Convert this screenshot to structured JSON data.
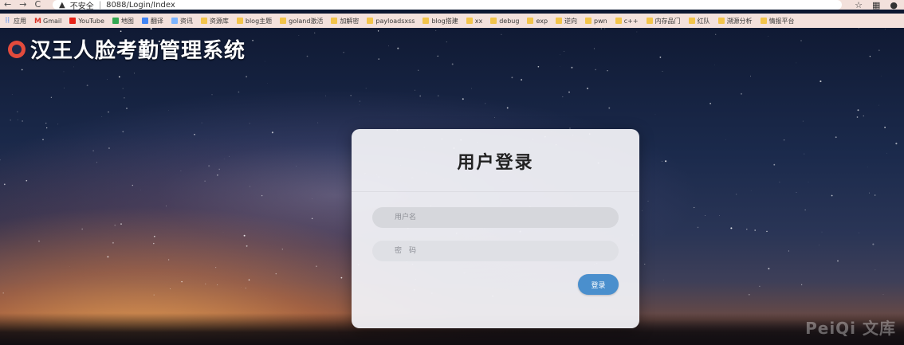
{
  "browser": {
    "nav": {
      "back": "←",
      "forward": "→",
      "reload": "C"
    },
    "address": {
      "warning": "不安全",
      "url": "8088/Login/Index"
    },
    "actions": {
      "star": "☆",
      "qr": "▦",
      "profile": "●"
    },
    "bookmarks": [
      {
        "label": "应用",
        "icon": "apps-icon"
      },
      {
        "label": "Gmail",
        "icon": "gmail-icon"
      },
      {
        "label": "YouTube",
        "icon": "youtube-icon"
      },
      {
        "label": "地图",
        "icon": "maps-icon"
      },
      {
        "label": "翻译",
        "icon": "translate-icon"
      },
      {
        "label": "资讯",
        "icon": "news-icon"
      },
      {
        "label": "资源库",
        "icon": "folder-icon"
      },
      {
        "label": "blog主题",
        "icon": "folder-icon"
      },
      {
        "label": "goland激活",
        "icon": "folder-icon"
      },
      {
        "label": "加解密",
        "icon": "folder-icon"
      },
      {
        "label": "payloadsxss",
        "icon": "folder-icon"
      },
      {
        "label": "blog搭建",
        "icon": "folder-icon"
      },
      {
        "label": "xx",
        "icon": "folder-icon"
      },
      {
        "label": "debug",
        "icon": "folder-icon"
      },
      {
        "label": "exp",
        "icon": "folder-icon"
      },
      {
        "label": "逆向",
        "icon": "folder-icon"
      },
      {
        "label": "pwn",
        "icon": "folder-icon"
      },
      {
        "label": "c++",
        "icon": "folder-icon"
      },
      {
        "label": "内存品门",
        "icon": "folder-icon"
      },
      {
        "label": "红队",
        "icon": "folder-icon"
      },
      {
        "label": "溯源分析",
        "icon": "folder-icon"
      },
      {
        "label": "情报平台",
        "icon": "folder-icon"
      }
    ]
  },
  "header": {
    "title": "汉王人脸考勤管理系统"
  },
  "login": {
    "title": "用户登录",
    "username_placeholder": "用户名",
    "password_placeholder": "密　码",
    "submit_label": "登录"
  },
  "watermark": "PeiQi 文库",
  "colors": {
    "button": "#4a8fcd",
    "card": "#f2f2f6"
  }
}
